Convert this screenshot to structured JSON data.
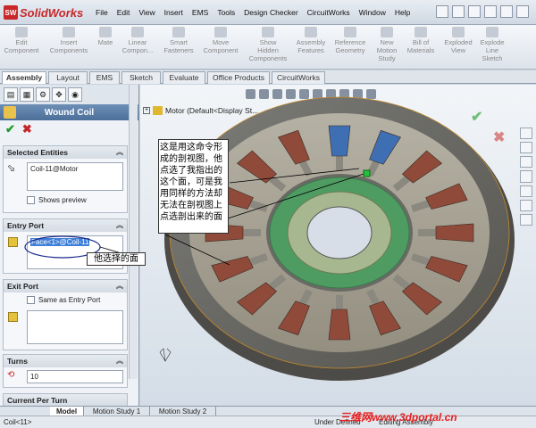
{
  "app": {
    "name": "SolidWorks",
    "logo_mark": "SW"
  },
  "menu": [
    "File",
    "Edit",
    "View",
    "Insert",
    "EMS",
    "Tools",
    "Design Checker",
    "CircuitWorks",
    "Window",
    "Help"
  ],
  "commands": [
    {
      "label": "Edit\nComponent"
    },
    {
      "label": "Insert\nComponents"
    },
    {
      "label": "Mate"
    },
    {
      "label": "Linear\nCompon..."
    },
    {
      "label": "Smart\nFasteners"
    },
    {
      "label": "Move\nComponent"
    },
    {
      "label": "Show\nHidden\nComponents"
    },
    {
      "label": "Assembly\nFeatures"
    },
    {
      "label": "Reference\nGeometry"
    },
    {
      "label": "New\nMotion\nStudy"
    },
    {
      "label": "Bill of\nMaterials"
    },
    {
      "label": "Exploded\nView"
    },
    {
      "label": "Explode\nLine\nSketch"
    }
  ],
  "tabs": [
    "Assembly",
    "Layout",
    "EMS",
    "Sketch",
    "Evaluate",
    "Office Products",
    "CircuitWorks"
  ],
  "panel": {
    "title": "Wound Coil",
    "selected_entities": {
      "header": "Selected Entities",
      "value": "Coil-11@Motor",
      "show_preview": "Shows preview"
    },
    "entry_port": {
      "header": "Entry Port",
      "value": "Face<1>@Coil-11"
    },
    "exit_port": {
      "header": "Exit Port",
      "same_as_entry": "Same as Entry Port"
    },
    "turns": {
      "header": "Turns",
      "value": "10"
    },
    "current_per_turn": {
      "header": "Current Per Turn"
    }
  },
  "viewport": {
    "tree_label": "Motor  (Default<Display St..."
  },
  "annotations": {
    "callout_main": "这是用这命令形成的剖视图，他点选了我指出的这个面，可是我用同样的方法却无法在剖视图上点选剖出来的面",
    "callout_selected": "他选择的面"
  },
  "bottom_tabs": [
    "Model",
    "Motion Study 1",
    "Motion Study 2"
  ],
  "status": {
    "left": "Coil<11>",
    "mid": "Under Defined",
    "right": "Editing Assembly"
  },
  "watermark": "三维网www.3dportal.cn",
  "colors": {
    "accent": "#4c6f9a",
    "coil": "#8f4a3a",
    "green_ring": "#4f9c63"
  }
}
